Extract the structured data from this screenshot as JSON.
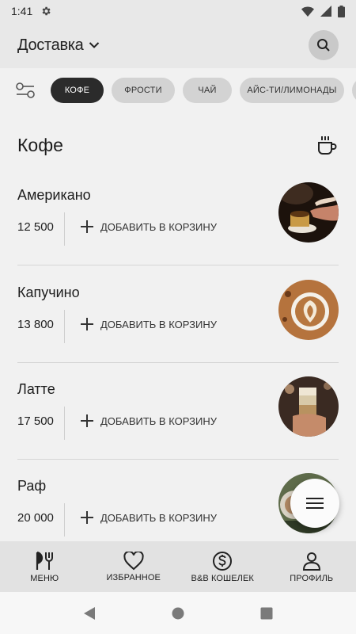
{
  "status_bar": {
    "time": "1:41"
  },
  "header": {
    "title": "Доставка"
  },
  "chips": [
    {
      "label": "КОФЕ",
      "active": true
    },
    {
      "label": "ФРОСТИ",
      "active": false
    },
    {
      "label": "ЧАЙ",
      "active": false
    },
    {
      "label": "АЙС-ТИ/ЛИМОНАДЫ",
      "active": false
    }
  ],
  "section": {
    "title": "Кофе"
  },
  "products": [
    {
      "name": "Американо",
      "price": "12 500",
      "add_label": "ДОБАВИТЬ В КОРЗИНУ"
    },
    {
      "name": "Капучино",
      "price": "13 800",
      "add_label": "ДОБАВИТЬ В КОРЗИНУ"
    },
    {
      "name": "Латте",
      "price": "17 500",
      "add_label": "ДОБАВИТЬ В КОРЗИНУ"
    },
    {
      "name": "Раф",
      "price": "20 000",
      "add_label": "ДОБАВИТЬ В КОРЗИНУ"
    }
  ],
  "bottom_nav": [
    {
      "label": "МЕНЮ",
      "icon": "fork-knife-icon"
    },
    {
      "label": "ИЗБРАННОЕ",
      "icon": "heart-icon"
    },
    {
      "label": "B&B КОШЕЛЕК",
      "icon": "dollar-circle-icon"
    },
    {
      "label": "ПРОФИЛЬ",
      "icon": "person-icon"
    }
  ]
}
